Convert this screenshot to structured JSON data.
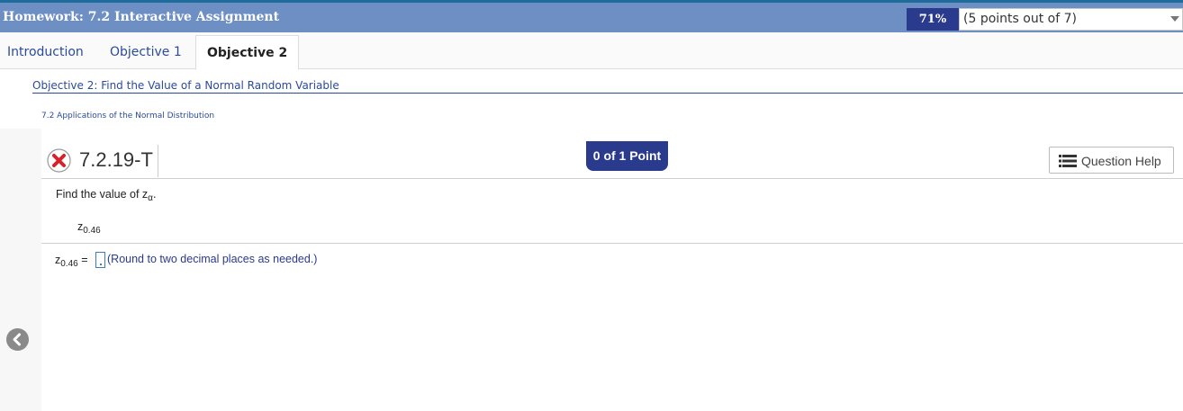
{
  "header": {
    "title": "Homework: 7.2 Interactive Assignment",
    "score_percent": "71%",
    "score_detail": "(5 points out of 7)"
  },
  "tabs": [
    {
      "label": "Introduction",
      "active": false
    },
    {
      "label": "Objective 1",
      "active": false
    },
    {
      "label": "Objective 2",
      "active": true
    }
  ],
  "objective": {
    "heading": "Objective 2: Find the Value of a Normal Random Variable",
    "section": "7.2 Applications of the Normal Distribution"
  },
  "question": {
    "status_icon": "incorrect-x-icon",
    "number": "7.2.19-T",
    "points": "0 of 1 Point",
    "help_label": "Question Help",
    "prompt": "Find the value of z",
    "prompt_sub": "α",
    "prompt_end": ".",
    "expr_main": "z",
    "expr_sub": "0.46",
    "answer_lhs_main": "z",
    "answer_lhs_sub": "0.46",
    "answer_eq": " =",
    "answer_value": "",
    "answer_hint": "(Round to two decimal places as needed.)"
  },
  "nav": {
    "back_icon": "chevron-left-icon"
  },
  "colors": {
    "header_bg": "#6e8fc4",
    "badge_bg": "#2a3a8c",
    "link_blue": "#2a4a9c",
    "incorrect_red": "#d6222a"
  }
}
